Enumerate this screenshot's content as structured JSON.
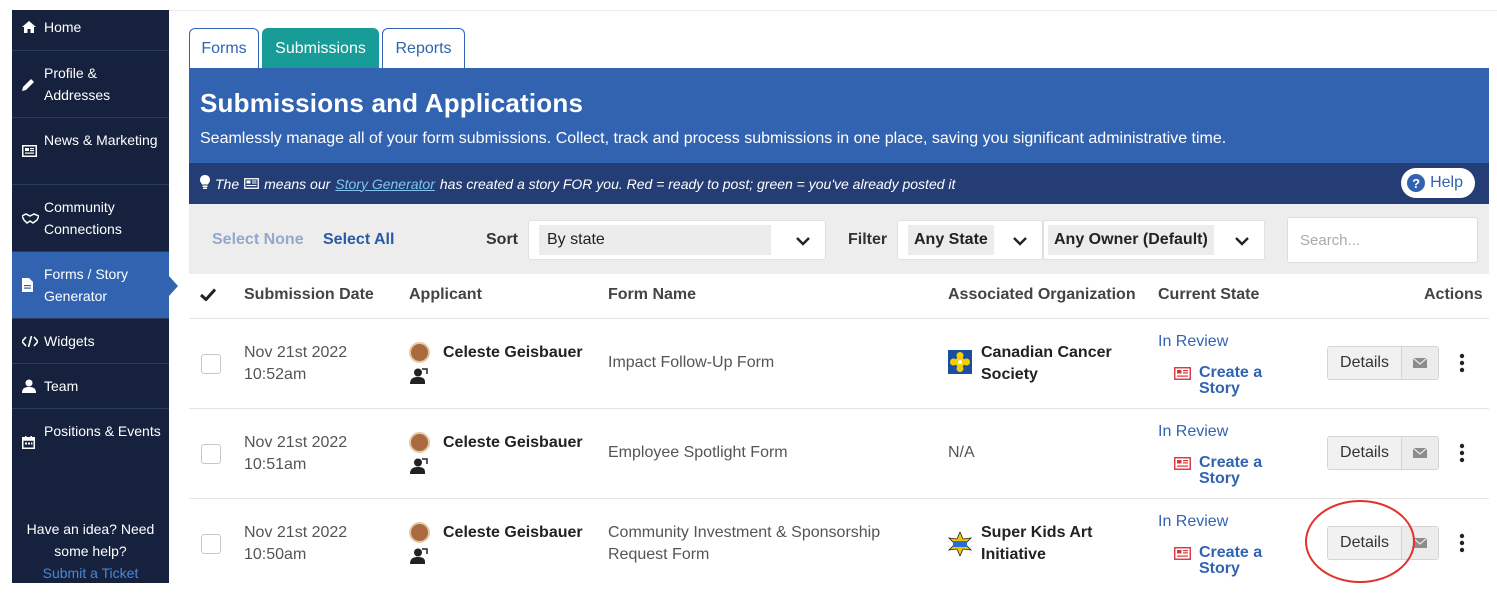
{
  "sidebar": {
    "items": [
      {
        "label": "Home",
        "icon": "home-icon"
      },
      {
        "label": "Profile & Addresses",
        "icon": "pencil-icon"
      },
      {
        "label": "News & Marketing",
        "icon": "newspaper-icon"
      },
      {
        "label": "Community Connections",
        "icon": "handshake-icon"
      },
      {
        "label": "Forms / Story Generator",
        "icon": "document-icon"
      },
      {
        "label": "Widgets",
        "icon": "code-icon"
      },
      {
        "label": "Team",
        "icon": "user-icon"
      },
      {
        "label": "Positions & Events",
        "icon": "calendar-icon"
      }
    ],
    "help_text": "Have an idea? Need some help?",
    "ticket_link": "Submit a Ticket"
  },
  "tabs": [
    "Forms",
    "Submissions",
    "Reports"
  ],
  "banner": {
    "title": "Submissions and Applications",
    "subtitle": "Seamlessly manage all of your form submissions. Collect, track and process submissions in one place, saving you significant administrative time."
  },
  "tip": {
    "prefix": "The",
    "middle": "means our",
    "link": "Story Generator",
    "suffix": "has created a story FOR you. Red = ready to post; green = you've already posted it",
    "help": "Help"
  },
  "toolbar": {
    "select_none": "Select None",
    "select_all": "Select All",
    "sort_label": "Sort",
    "sort_value": "By state",
    "filter_label": "Filter",
    "state_value": "Any State",
    "owner_value": "Any Owner (Default)",
    "search_placeholder": "Search..."
  },
  "table": {
    "headers": {
      "date": "Submission Date",
      "applicant": "Applicant",
      "form": "Form Name",
      "org": "Associated Organization",
      "state": "Current State",
      "actions": "Actions"
    },
    "rows": [
      {
        "date": "Nov 21st 2022",
        "time": "10:52am",
        "applicant": "Celeste Geisbauer",
        "form": "Impact Follow-Up Form",
        "org": "Canadian Cancer Society",
        "org_logo": "cancer-society-logo",
        "state": "In Review",
        "story": "Create a Story",
        "details": "Details"
      },
      {
        "date": "Nov 21st 2022",
        "time": "10:51am",
        "applicant": "Celeste Geisbauer",
        "form": "Employee Spotlight Form",
        "org": "N/A",
        "org_logo": "",
        "state": "In Review",
        "story": "Create a Story",
        "details": "Details"
      },
      {
        "date": "Nov 21st 2022",
        "time": "10:50am",
        "applicant": "Celeste Geisbauer",
        "form": "Community Investment & Sponsorship Request Form",
        "org": "Super Kids Art Initiative",
        "org_logo": "super-kids-logo",
        "state": "In Review",
        "story": "Create a Story",
        "details": "Details"
      }
    ]
  },
  "colors": {
    "primary": "#3263b1",
    "tab_active": "#189c97",
    "sidebar": "#15213d",
    "highlight_circle": "#e0312b"
  }
}
